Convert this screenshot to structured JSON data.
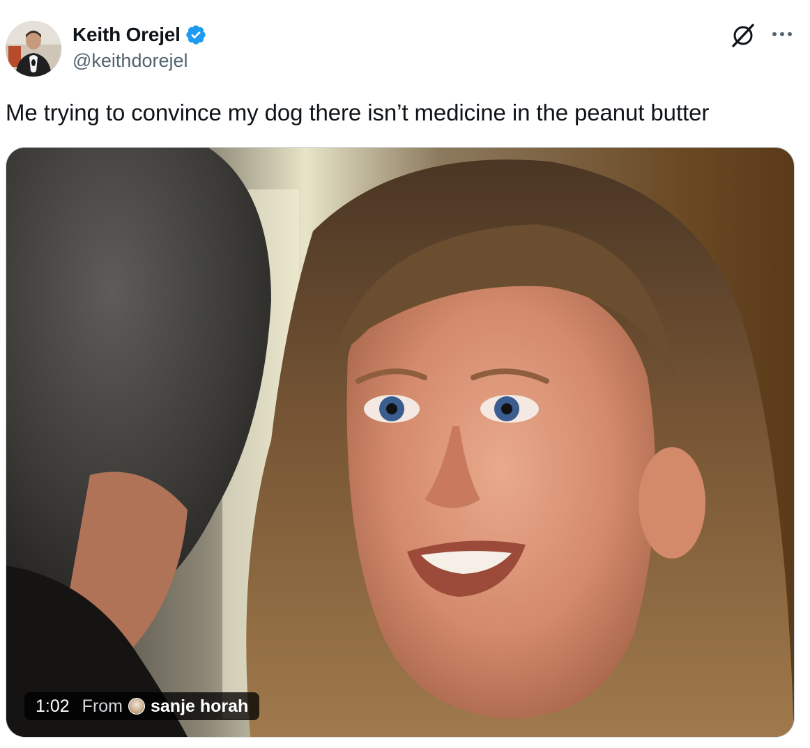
{
  "tweet": {
    "author": {
      "display_name": "Keith Orejel",
      "handle": "@keithdorejel",
      "avatar_icon": "user-avatar",
      "verified": true,
      "verified_color": "#1d9bf0"
    },
    "text": "Me trying to convince my dog there isn’t medicine in the peanut butter",
    "actions": {
      "grok_icon": "grok-icon",
      "more_icon": "more-icon"
    },
    "media": {
      "type": "video",
      "duration": "1:02",
      "from_label": "From",
      "source_name": "sanje horah",
      "source_avatar_icon": "source-avatar"
    }
  },
  "colors": {
    "text_primary": "#0f1419",
    "text_secondary": "#536471",
    "border": "#cfd9de",
    "brand_blue": "#1d9bf0"
  }
}
